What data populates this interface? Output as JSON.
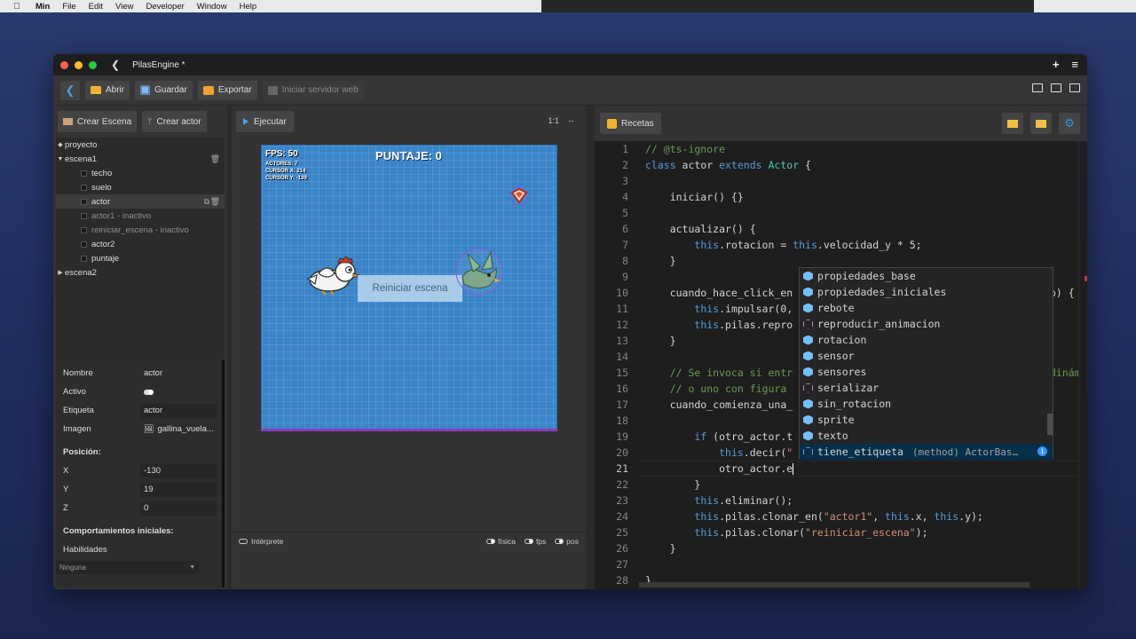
{
  "menubar": {
    "app": "Min",
    "items": [
      "File",
      "Edit",
      "View",
      "Developer",
      "Window",
      "Help"
    ]
  },
  "window": {
    "title": "PilasEngine *",
    "add_label": "+",
    "menu_label": "≡"
  },
  "toolbar": {
    "open": "Abrir",
    "save": "Guardar",
    "export": "Exportar",
    "server": "Iniciar servidor web"
  },
  "left": {
    "create_scene": "Crear Escena",
    "create_actor": "Crear actor",
    "tree": [
      {
        "label": "proyecto"
      },
      {
        "label": "escena1"
      },
      {
        "label": "techo"
      },
      {
        "label": "suelo"
      },
      {
        "label": "actor"
      },
      {
        "label": "actor1 - inactivo"
      },
      {
        "label": "reiniciar_escena - inactivo"
      },
      {
        "label": "actor2"
      },
      {
        "label": "puntaje"
      },
      {
        "label": "escena2"
      }
    ],
    "props": {
      "name_label": "Nombre",
      "name_value": "actor",
      "active_label": "Activo",
      "tag_label": "Etiqueta",
      "tag_value": "actor",
      "image_label": "Imagen",
      "image_value": "gallina_vuela...",
      "position_label": "Posición:",
      "x_label": "X",
      "x_value": "-130",
      "y_label": "Y",
      "y_value": "19",
      "z_label": "Z",
      "z_value": "0",
      "behaviors_label": "Comportamientos iniciales:",
      "skills_label": "Habilidades",
      "skills_value": "Ninguna"
    }
  },
  "middle": {
    "run": "Ejecutar",
    "ratio": "1:1",
    "stage": {
      "fps": "FPS: 50",
      "actors": "ACTORES: 7",
      "cursor_x": "CURSOR X: 214",
      "cursor_y": "CURSOR Y: -139",
      "score": "PUNTAJE: 0",
      "reset": "Reiniciar escena"
    },
    "bottom": {
      "interpreter": "Intérprete",
      "physics": "física",
      "fps": "fps",
      "pos": "pos"
    }
  },
  "right": {
    "recipes": "Recetas",
    "code": [
      {
        "n": "1",
        "t": "// @ts-ignore"
      },
      {
        "n": "2",
        "t": "class actor extends Actor {"
      },
      {
        "n": "3",
        "t": ""
      },
      {
        "n": "4",
        "t": "    iniciar() {}"
      },
      {
        "n": "5",
        "t": ""
      },
      {
        "n": "6",
        "t": "    actualizar() {"
      },
      {
        "n": "7",
        "t": "        this.rotacion = this.velocidad_y * 5;"
      },
      {
        "n": "8",
        "t": "    }"
      },
      {
        "n": "9",
        "t": ""
      },
      {
        "n": "10",
        "t": "    cuando_hace_click_en"
      },
      {
        "n": "11",
        "t": "        this.impulsar(0,"
      },
      {
        "n": "12",
        "t": "        this.pilas.repro"
      },
      {
        "n": "13",
        "t": "    }"
      },
      {
        "n": "14",
        "t": ""
      },
      {
        "n": "15",
        "t": "    // Se invoca si entr"
      },
      {
        "n": "16",
        "t": "    // o uno con figura"
      },
      {
        "n": "17",
        "t": "    cuando_comienza_una_"
      },
      {
        "n": "18",
        "t": ""
      },
      {
        "n": "19",
        "t": "        if (otro_actor.t"
      },
      {
        "n": "20",
        "t": "            this.decir(\""
      },
      {
        "n": "21",
        "t": "            otro_actor.e"
      },
      {
        "n": "22",
        "t": "        }"
      },
      {
        "n": "23",
        "t": "        this.eliminar();"
      },
      {
        "n": "24",
        "t": "        this.pilas.clonar_en(\"actor1\", this.x, this.y);"
      },
      {
        "n": "25",
        "t": "        this.pilas.clonar(\"reiniciar_escena\");"
      },
      {
        "n": "26",
        "t": "    }"
      },
      {
        "n": "27",
        "t": ""
      },
      {
        "n": "28",
        "t": "}"
      }
    ],
    "tail10": "o) {",
    "tail15": "dinámi",
    "suggestions": [
      {
        "label": "propiedades_base",
        "kind": "field"
      },
      {
        "label": "propiedades_iniciales",
        "kind": "field"
      },
      {
        "label": "rebote",
        "kind": "field"
      },
      {
        "label": "reproducir_animacion",
        "kind": "method"
      },
      {
        "label": "rotacion",
        "kind": "field"
      },
      {
        "label": "sensor",
        "kind": "field"
      },
      {
        "label": "sensores",
        "kind": "field"
      },
      {
        "label": "serializar",
        "kind": "method"
      },
      {
        "label": "sin_rotacion",
        "kind": "field"
      },
      {
        "label": "sprite",
        "kind": "field"
      },
      {
        "label": "texto",
        "kind": "field"
      },
      {
        "label": "tiene_etiqueta",
        "kind": "method",
        "detail": "(method) ActorBas…"
      }
    ]
  }
}
